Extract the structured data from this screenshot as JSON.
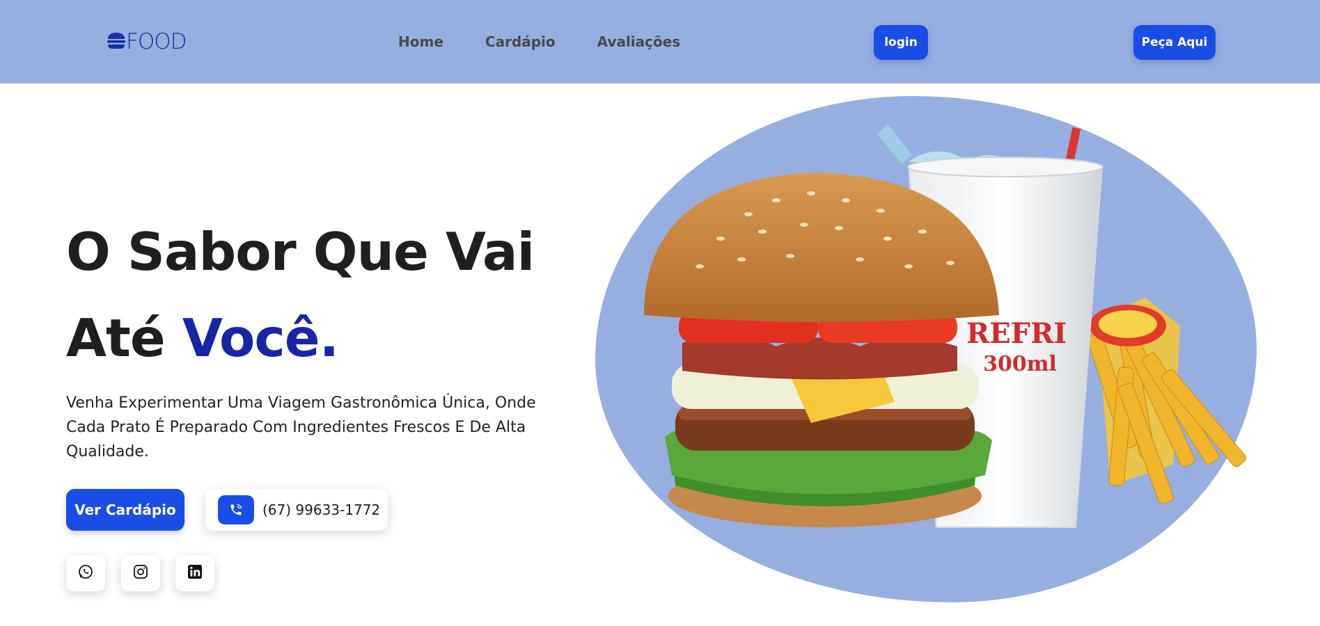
{
  "header": {
    "logo_text": "FOOD",
    "nav": [
      "Home",
      "Cardápio",
      "Avaliações"
    ],
    "login_label": "login",
    "order_label": "Peça Aqui"
  },
  "hero": {
    "title_line1": "O Sabor Que Vai",
    "title_line2_prefix": "Até ",
    "title_line2_accent": "Você.",
    "description": "Venha Experimentar Uma Viagem Gastronômica Única, Onde Cada Prato É Preparado Com Ingredientes Frescos E De Alta Qualidade.",
    "menu_button": "Ver Cardápio",
    "phone": "(67) 99633-1772",
    "cup_text_1": "REFRI",
    "cup_text_2": "300ml"
  },
  "icons": [
    "burger-logo-icon",
    "phone-icon",
    "whatsapp-icon",
    "instagram-icon",
    "linkedin-icon"
  ],
  "colors": {
    "header_bg": "#97aee1",
    "primary": "#1a4de6",
    "accent_text": "#1826a6"
  }
}
